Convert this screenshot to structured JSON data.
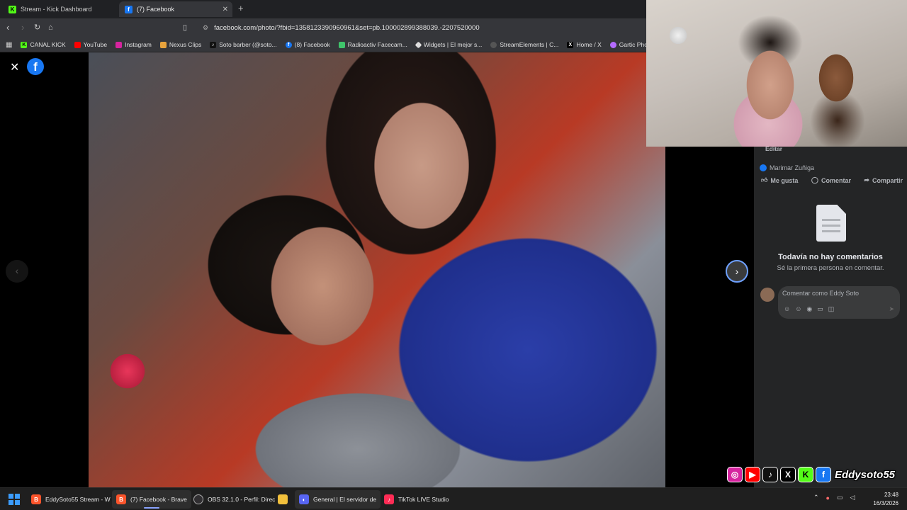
{
  "browser": {
    "tabs": [
      {
        "label": "Stream - Kick Dashboard",
        "icon": "kick-icon",
        "active": false
      },
      {
        "label": "(7) Facebook",
        "icon": "facebook-icon",
        "active": true
      }
    ],
    "url": "facebook.com/photo/?fbid=1358123390960961&set=pb.100002899388039.-2207520000",
    "bookmarks": [
      {
        "label": "CANAL KICK",
        "icon": "kick-icon",
        "color": "#53fc18"
      },
      {
        "label": "YouTube",
        "icon": "youtube-icon",
        "color": "#ff0000"
      },
      {
        "label": "Instagram",
        "icon": "instagram-icon",
        "color": "#d6249f"
      },
      {
        "label": "Nexus Clips",
        "icon": "nexus-icon",
        "color": "#e8a33c"
      },
      {
        "label": "Soto barber (@soto...",
        "icon": "tiktok-icon",
        "color": "#111111"
      },
      {
        "label": "(8) Facebook",
        "icon": "facebook-icon",
        "color": "#1877f2"
      },
      {
        "label": "Radioactiv Facecam...",
        "icon": "radioactiv-icon",
        "color": "#3fc46b"
      },
      {
        "label": "Widgets | El mejor s...",
        "icon": "widgets-icon",
        "color": "#dddddd"
      },
      {
        "label": "StreamElements | C...",
        "icon": "streamelements-icon",
        "color": "#cccccc"
      },
      {
        "label": "Home / X",
        "icon": "x-icon",
        "color": "#000000"
      },
      {
        "label": "Gartic Phone - Tele",
        "icon": "gartic-icon",
        "color": "#b46bff"
      }
    ]
  },
  "panel": {
    "edit_label": "Editar",
    "reaction_name": "Marimar Zuñiga",
    "actions": {
      "like": "Me gusta",
      "comment": "Comentar",
      "share": "Compartir"
    },
    "no_comments_title": "Todavía no hay comentarios",
    "no_comments_sub": "Sé la primera persona en comentar.",
    "comment_placeholder": "Comentar como Eddy Soto"
  },
  "overlay": {
    "handle": "Eddysoto55",
    "socials": [
      "instagram",
      "youtube",
      "tiktok",
      "x",
      "kick",
      "facebook"
    ]
  },
  "taskbar": {
    "items": [
      {
        "label": "EddySoto55 Stream - W",
        "icon": "brave-icon",
        "color": "#fb542b",
        "active": false
      },
      {
        "label": "(7) Facebook - Brave",
        "icon": "brave-icon",
        "color": "#fb542b",
        "active": true
      },
      {
        "label": "OBS 32.1.0 - Perfil: Direc",
        "icon": "obs-icon",
        "color": "#302e31",
        "active": false
      },
      {
        "label": "",
        "icon": "folder-icon",
        "color": "#f2c03c",
        "active": false
      },
      {
        "label": "General | El servidor de",
        "icon": "discord-icon",
        "color": "#5865f2",
        "active": false
      },
      {
        "label": "TikTok LIVE Studio",
        "icon": "tiktok-icon",
        "color": "#fe2c55",
        "active": false
      }
    ],
    "time": "23:48",
    "date": "16/3/2026"
  }
}
